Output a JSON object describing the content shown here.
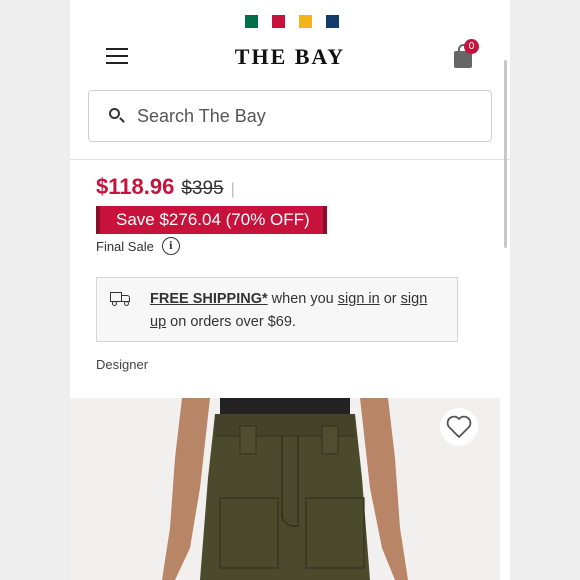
{
  "brand": {
    "name": "THE BAY",
    "stripe_colors": [
      "#00704a",
      "#c7133c",
      "#f2b31b",
      "#123a6b"
    ]
  },
  "header": {
    "menu_icon": "hamburger-menu-icon",
    "cart_icon": "shopping-bag-icon",
    "cart_count": "0"
  },
  "search": {
    "placeholder": "Search The Bay",
    "icon": "search-icon"
  },
  "product": {
    "sale_price": "$118.96",
    "original_price": "$395",
    "save_text": "Save $276.04 (70% OFF)",
    "final_sale_label": "Final Sale",
    "designer_label": "Designer",
    "wishlist_icon": "heart-icon"
  },
  "shipping": {
    "icon": "truck-icon",
    "free_shipping": "FREE SHIPPING*",
    "when_you": " when you ",
    "sign_in": "sign in",
    "or": " or ",
    "sign_up": "sign up",
    "suffix": " on orders over $69."
  },
  "colors": {
    "accent": "#c7133c"
  }
}
